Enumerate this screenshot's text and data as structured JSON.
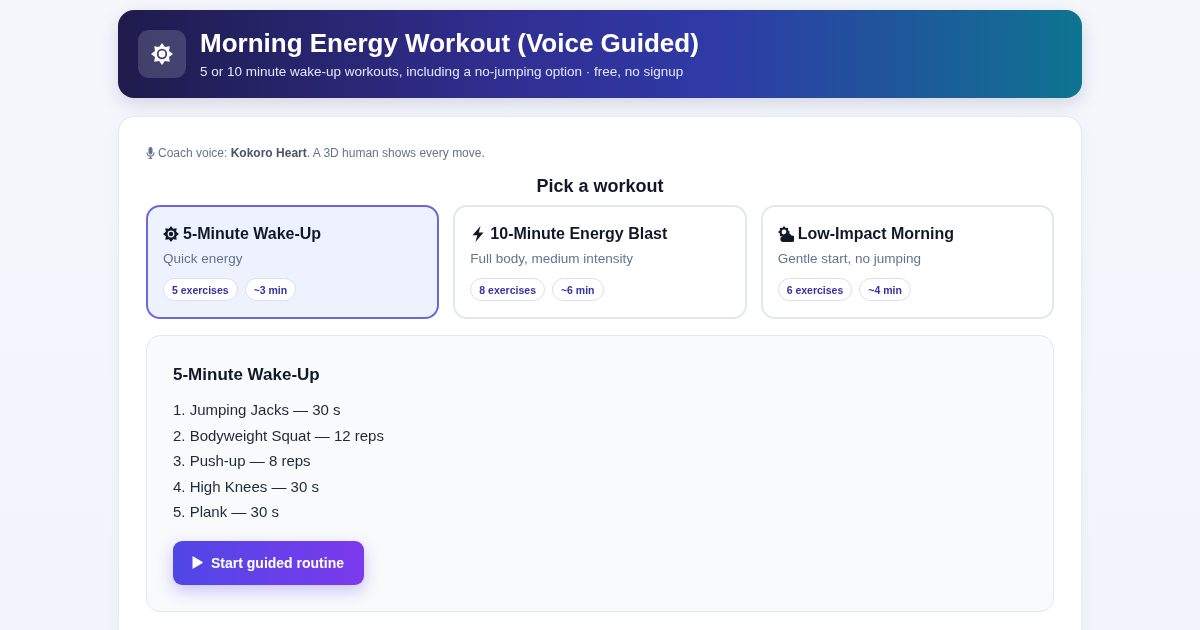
{
  "header": {
    "title": "Morning Energy Workout (Voice Guided)",
    "subtitle": "5 or 10 minute wake-up workouts, including a no-jumping option · free, no signup"
  },
  "voice_note": "Coach voice: **Kokoro Heart**. A 3D human shows every move.",
  "picker": {
    "heading": "Pick a workout",
    "workouts": [
      {
        "title": "5-Minute Wake-Up",
        "description": "Quick energy",
        "chips": [
          "5 exercises",
          "~3 min"
        ],
        "selected": true
      },
      {
        "title": "10-Minute Energy Blast",
        "description": "Full body, medium intensity",
        "chips": [
          "8 exercises",
          "~6 min"
        ],
        "selected": false
      },
      {
        "title": "Low-Impact Morning",
        "description": "Gentle start, no jumping",
        "chips": [
          "6 exercises",
          "~4 min"
        ],
        "selected": false
      }
    ]
  },
  "details": {
    "title": "5-Minute Wake-Up",
    "steps": [
      "1. Jumping Jacks — 30 s",
      "2. Bodyweight Squat — 12 reps",
      "3. Push-up — 8 reps",
      "4. High Knees — 30 s",
      "5. Plank — 30 s"
    ],
    "start_button": "Start guided routine"
  }
}
